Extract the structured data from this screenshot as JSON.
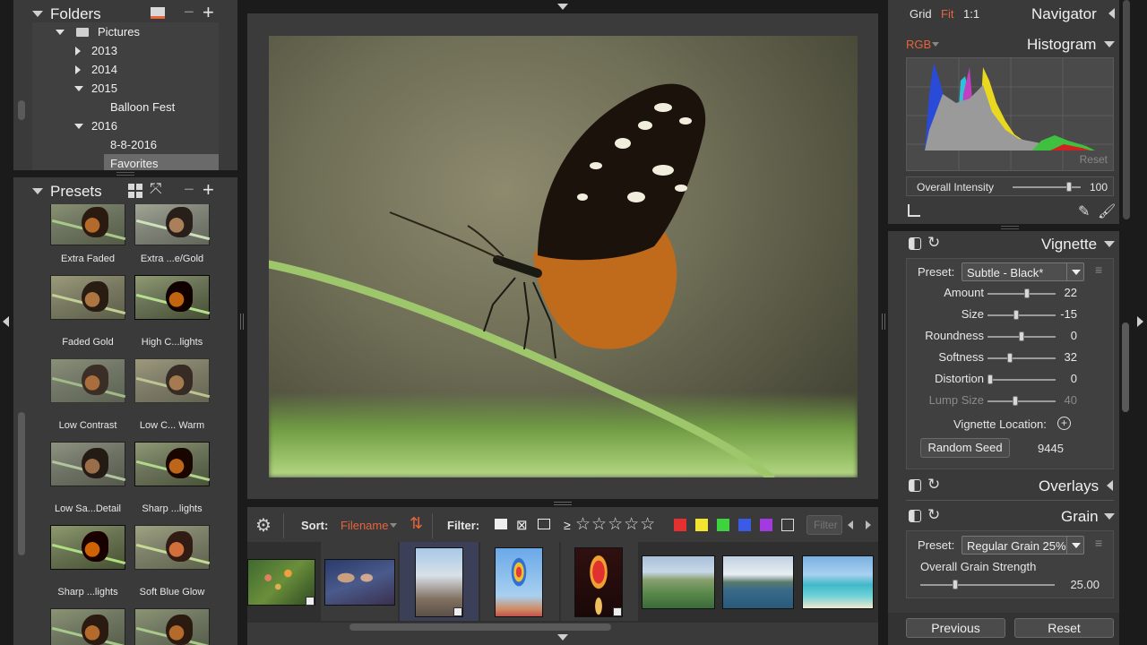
{
  "folders": {
    "title": "Folders",
    "items": [
      {
        "label": "Pictures",
        "expanded": true
      },
      {
        "label": "2013",
        "expanded": false
      },
      {
        "label": "2014",
        "expanded": false
      },
      {
        "label": "2015",
        "expanded": true
      },
      {
        "label": "Balloon Fest"
      },
      {
        "label": "2016",
        "expanded": true
      },
      {
        "label": "8-8-2016"
      },
      {
        "label": "Favorites",
        "selected": true
      }
    ]
  },
  "presets": {
    "title": "Presets",
    "items": [
      "Extra Faded",
      "Extra ...e/Gold",
      "Faded Gold",
      "High C...lights",
      "Low Contrast",
      "Low C... Warm",
      "Low Sa...Detail",
      "Sharp ...lights",
      "Sharp ...lights",
      "Soft Blue Glow"
    ]
  },
  "navigator": {
    "grid": "Grid",
    "fit": "Fit",
    "one": "1:1",
    "title": "Navigator"
  },
  "histogram": {
    "mode": "RGB",
    "title": "Histogram",
    "reset": "Reset",
    "intensity_label": "Overall Intensity",
    "intensity_value": "100",
    "intensity_level": 0.86
  },
  "vignette": {
    "title": "Vignette",
    "preset_label": "Preset:",
    "preset_value": "Subtle - Black*",
    "sliders": [
      {
        "label": "Amount",
        "value": "22",
        "level": 0.58,
        "dim": false
      },
      {
        "label": "Size",
        "value": "-15",
        "level": 0.42,
        "dim": false
      },
      {
        "label": "Roundness",
        "value": "0",
        "level": 0.5,
        "dim": false
      },
      {
        "label": "Softness",
        "value": "32",
        "level": 0.32,
        "dim": false
      },
      {
        "label": "Distortion",
        "value": "0",
        "level": 0.0,
        "dim": false
      },
      {
        "label": "Lump Size",
        "value": "40",
        "level": 0.4,
        "dim": true
      }
    ],
    "location_label": "Vignette Location:",
    "random_seed_label": "Random Seed",
    "random_seed_value": "9445"
  },
  "overlays": {
    "title": "Overlays"
  },
  "grain": {
    "title": "Grain",
    "preset_label": "Preset:",
    "preset_value": "Regular Grain 25%",
    "strength_label": "Overall Grain Strength",
    "strength_value": "25.00",
    "strength_level": 0.25
  },
  "footer": {
    "previous": "Previous",
    "reset": "Reset"
  },
  "filmstrip": {
    "sort_label": "Sort:",
    "sort_value": "Filename",
    "filter_label": "Filter:",
    "gte": "≥",
    "filter_placeholder": "Filter"
  },
  "colors": {
    "accent": "#e8643c",
    "bg": "#1b1b1b",
    "panel": "#3a3a3a"
  }
}
